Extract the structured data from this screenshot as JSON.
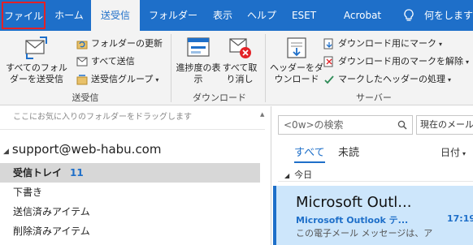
{
  "tabs": {
    "file": "ファイル",
    "home": "ホーム",
    "send_receive": "送受信",
    "folder": "フォルダー",
    "view": "表示",
    "help": "ヘルプ",
    "eset": "ESET",
    "acrobat": "Acrobat"
  },
  "tell_me": "何をしますか",
  "ribbon": {
    "send_receive_all": "すべてのフォルダーを送受信",
    "update_folder": "フォルダーの更新",
    "send_all": "すべて送信",
    "send_receive_groups": "送受信グループ",
    "group_send_receive": "送受信",
    "show_progress": "進捗度の表示",
    "cancel_all": "すべて取り消し",
    "group_download": "ダウンロード",
    "download_headers": "ヘッダーをダウンロード",
    "mark_to_download": "ダウンロード用にマーク",
    "unmark_to_download": "ダウンロード用のマークを解除",
    "process_marked_headers": "マークしたヘッダーの処理",
    "group_server": "サーバー"
  },
  "folders": {
    "favorites_hint": "ここにお気に入りのフォルダーをドラッグします",
    "account": "support@web-habu.com",
    "items": [
      {
        "label": "受信トレイ",
        "count": "11"
      },
      {
        "label": "下書き"
      },
      {
        "label": "送信済みアイテム"
      },
      {
        "label": "削除済みアイテム"
      }
    ]
  },
  "messages": {
    "search_placeholder": "<0w>の検索",
    "scope": "現在のメールボックス",
    "tab_all": "すべて",
    "tab_unread": "未読",
    "sort": "日付",
    "group_today": "今日",
    "item": {
      "sender": "Microsoft Outl...",
      "subject": "Microsoft Outlook テ...",
      "time": "17:19",
      "preview": "この電子メール メッセージは、ア"
    }
  },
  "colors": {
    "accent": "#1e6fc9",
    "ribbon_bg": "#f3f3f3",
    "selection": "#cde6fb",
    "highlight_border": "#e32227"
  }
}
